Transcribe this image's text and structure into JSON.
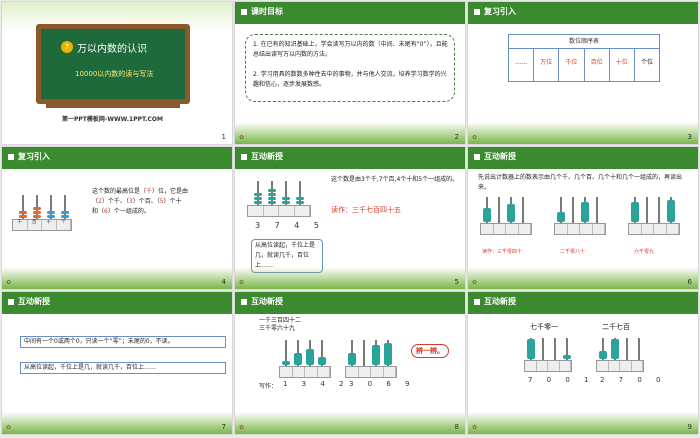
{
  "slides": [
    {
      "page": "1",
      "board_badge": "7",
      "board_title": "万以内数的认识",
      "board_sub": "10000以内数的读与写法",
      "footer": "第一PPT模板网-WWW.1PPT.COM"
    },
    {
      "page": "2",
      "title": "课时目标",
      "points": [
        "1. 在已有的知识基础上，学会读写万以内的数（中间、末尾有“0”），且能总结出读写万以内数的方法。",
        "2. 学习用具的数数多种性去中的事物，并与他人交流，培养学习数学的兴趣和信心，逐步发展数感。"
      ]
    },
    {
      "page": "3",
      "title": "复习引入",
      "table_title": "数位顺序表",
      "cols": [
        "……",
        "万位",
        "千位",
        "百位",
        "十位",
        "个位"
      ]
    },
    {
      "page": "4",
      "title": "复习引入",
      "line1": "这个数的最高位是（",
      "blank1": "千",
      "line1b": "）位，它是由",
      "line2a": "（",
      "b2": "2",
      "line2b": "）个千、（",
      "b3": "3",
      "line2c": "）个百、（",
      "b4": "5",
      "line2d": "）个十",
      "line3a": "和（",
      "b5": "6",
      "line3b": "）个一组成的。",
      "labels": [
        "千",
        "百",
        "十",
        "个"
      ],
      "digits": "2 3 5 6"
    },
    {
      "page": "5",
      "title": "互动新授",
      "desc": "这个数是由3个千,7个百,4个十和5个一组成的。",
      "read": "读作：三千七百四十五",
      "digits": "3 7 4 5",
      "tip": "从高位读起，千位上是几，就读几千，百位上……"
    },
    {
      "page": "6",
      "title": "互动新授",
      "desc": "先说出计数器上的数表示由几个千、几个百、几个十和几个一组成的，再读出来。",
      "r1": "读作：三千零四十",
      "r2": "二千零八十",
      "r3": "六千零九",
      "d1": "3 0 4 0",
      "d2": "2 0 8 0",
      "d3": "6 0 0 9"
    },
    {
      "page": "7",
      "title": "互动新授",
      "t1": "中间有一个0或两个0，只读一个“零”；末尾的0，不读。",
      "t2": "从高位读起，千位上是几，就读几千，百位上……"
    },
    {
      "page": "8",
      "title": "互动新授",
      "n1": "一千三百四十二",
      "n2": "三千零六十九",
      "write": "写作：",
      "d1": "1 3 4 2",
      "d2": "3 0 6 9",
      "bubble": "辨一辨。"
    },
    {
      "page": "9",
      "title": "互动新授",
      "w1": "七千零一",
      "w2": "二千七百",
      "d1": "7 0 0 1",
      "d2": "2 7 0 0"
    }
  ],
  "colors": {
    "accent": "#3b8a2f",
    "board": "#1e6a3a",
    "red": "#d43b2a"
  }
}
